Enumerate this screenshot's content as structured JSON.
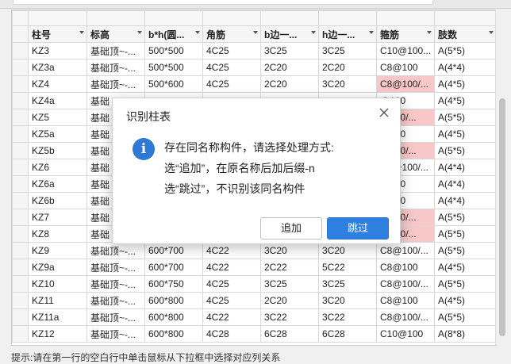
{
  "table": {
    "headers": [
      "柱号",
      "标高",
      "b*h(圆...",
      "角筋",
      "b边一...",
      "h边一...",
      "箍筋",
      "肢数"
    ],
    "rows": [
      [
        "KZ3",
        "基础顶~-...",
        "500*500",
        "4C25",
        "3C25",
        "3C25",
        "C10@100...",
        "A(5*5)"
      ],
      [
        "KZ3a",
        "基础顶~-...",
        "500*500",
        "4C25",
        "2C20",
        "2C20",
        "C8@100",
        "A(4*4)"
      ],
      [
        "KZ4",
        "基础顶~-...",
        "500*600",
        "4C25",
        "2C20",
        "3C20",
        "C8@100/...",
        "A(4*5)"
      ],
      [
        "KZ4a",
        "基础",
        "",
        "",
        "",
        "",
        "@100",
        "A(4*5)"
      ],
      [
        "KZ5",
        "基础",
        "",
        "",
        "",
        "",
        "@100/...",
        "A(5*5)"
      ],
      [
        "KZ5a",
        "基础",
        "",
        "",
        "",
        "",
        "@100",
        "A(4*5)"
      ],
      [
        "KZ5b",
        "基础",
        "",
        "",
        "",
        "",
        "@100/...",
        "A(5*5)"
      ],
      [
        "KZ6",
        "基础",
        "",
        "",
        "",
        "",
        "C8@100/...",
        "A(4*4)"
      ],
      [
        "KZ6a",
        "基础",
        "",
        "",
        "",
        "",
        "@100",
        "A(4*4)"
      ],
      [
        "KZ6b",
        "基础",
        "",
        "",
        "",
        "",
        "@100",
        "A(4*4)"
      ],
      [
        "KZ7",
        "基础",
        "",
        "",
        "",
        "",
        "@100/...",
        "A(5*5)"
      ],
      [
        "KZ8",
        "基础",
        "",
        "",
        "",
        "",
        "@100/...",
        "A(5*5)"
      ],
      [
        "KZ9",
        "基础顶~-...",
        "600*700",
        "4C22",
        "3C20",
        "3C20",
        "C8@100/...",
        "A(5*5)"
      ],
      [
        "KZ9a",
        "基础顶~-...",
        "600*700",
        "4C22",
        "2C22",
        "5C22",
        "C8@100",
        "A(4*5)"
      ],
      [
        "KZ10",
        "基础顶~-...",
        "600*750",
        "4C25",
        "3C25",
        "3C25",
        "C8@100/...",
        "A(5*5)"
      ],
      [
        "KZ11",
        "基础顶~-...",
        "600*800",
        "4C25",
        "2C20",
        "3C20",
        "C8@100",
        "A(4*5)"
      ],
      [
        "KZ11a",
        "基础顶~-...",
        "600*800",
        "4C22",
        "3C22",
        "3C22",
        "C8@100/...",
        "A(5*5)"
      ],
      [
        "KZ12",
        "基础顶~-...",
        "600*800",
        "4C28",
        "6C28",
        "6C28",
        "C10@100",
        "A(8*8)"
      ]
    ],
    "highlight_rows": [
      2,
      4,
      6,
      10,
      11
    ]
  },
  "status_text": "提示:请在第一行的空白行中单击鼠标从下拉框中选择对应列关系",
  "dialog": {
    "title": "识别柱表",
    "line1": "存在同名称构件，请选择处理方式:",
    "line2": "选“追加”，在原名称后加后缀-n",
    "line3": "选“跳过”，不识别该同名构件",
    "add_label": "追加",
    "skip_label": "跳过",
    "info_glyph": "i"
  },
  "colors": {
    "highlight": "#f8c8c8",
    "primary_button": "#2f7fe0",
    "info_icon": "#2f79d6"
  }
}
